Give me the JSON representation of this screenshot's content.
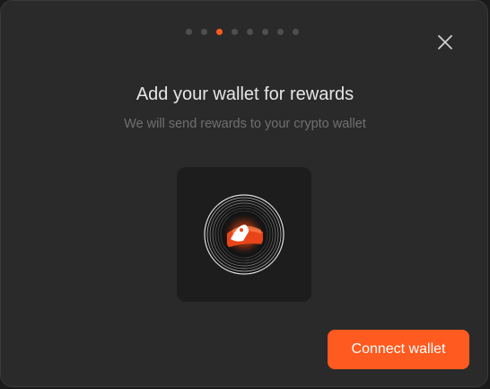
{
  "modal": {
    "title": "Add your wallet for rewards",
    "subtitle": "We will send rewards to your crypto wallet",
    "step_indicator": {
      "total_steps": 8,
      "current_step": 3
    },
    "close_icon": "close-icon",
    "illustration_icon": "crypto-coin-icon",
    "connect_button_label": "Connect wallet"
  },
  "colors": {
    "accent": "#ff5a1f",
    "modal_background": "#2a2a2a",
    "title_text": "#e6e6e6",
    "subtitle_text": "#707070",
    "inactive_dot": "#4f4f4f"
  }
}
